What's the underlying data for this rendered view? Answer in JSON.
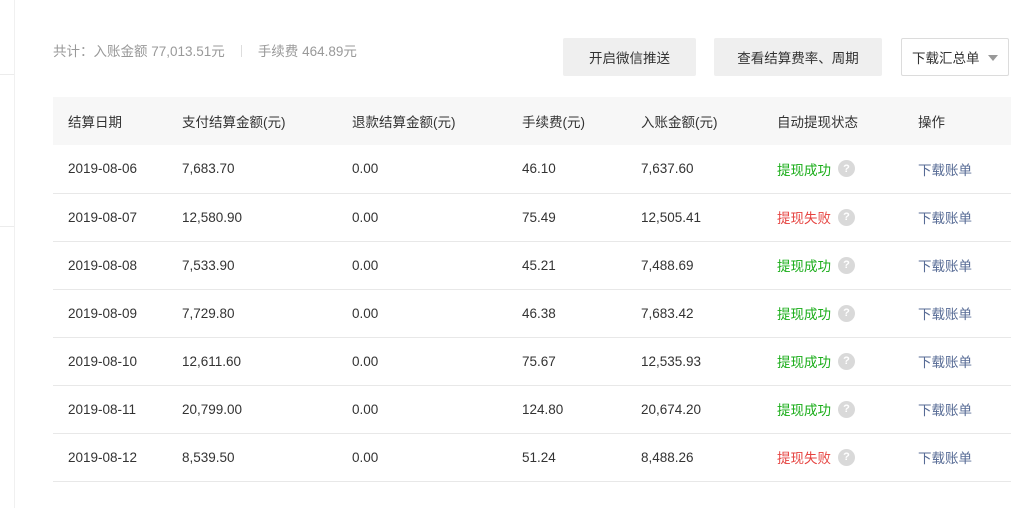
{
  "summary": {
    "income_text": "共计：入账金额 77,013.51元",
    "fee_text": "手续费 464.89元"
  },
  "toolbar": {
    "push_label": "开启微信推送",
    "rate_label": "查看结算费率、周期",
    "download_select_value": "下载汇总单"
  },
  "table": {
    "headers": [
      "结算日期",
      "支付结算金额(元)",
      "退款结算金额(元)",
      "手续费(元)",
      "入账金额(元)",
      "自动提现状态",
      "操作"
    ],
    "rows": [
      {
        "date": "2019-08-06",
        "pay": "7,683.70",
        "refund": "0.00",
        "fee": "46.10",
        "income": "7,637.60",
        "status": "提现成功",
        "status_type": "success",
        "help": "?",
        "action": "下载账单"
      },
      {
        "date": "2019-08-07",
        "pay": "12,580.90",
        "refund": "0.00",
        "fee": "75.49",
        "income": "12,505.41",
        "status": "提现失败",
        "status_type": "fail",
        "help": "?",
        "action": "下载账单"
      },
      {
        "date": "2019-08-08",
        "pay": "7,533.90",
        "refund": "0.00",
        "fee": "45.21",
        "income": "7,488.69",
        "status": "提现成功",
        "status_type": "success",
        "help": "?",
        "action": "下载账单"
      },
      {
        "date": "2019-08-09",
        "pay": "7,729.80",
        "refund": "0.00",
        "fee": "46.38",
        "income": "7,683.42",
        "status": "提现成功",
        "status_type": "success",
        "help": "?",
        "action": "下载账单"
      },
      {
        "date": "2019-08-10",
        "pay": "12,611.60",
        "refund": "0.00",
        "fee": "75.67",
        "income": "12,535.93",
        "status": "提现成功",
        "status_type": "success",
        "help": "?",
        "action": "下载账单"
      },
      {
        "date": "2019-08-11",
        "pay": "20,799.00",
        "refund": "0.00",
        "fee": "124.80",
        "income": "20,674.20",
        "status": "提现成功",
        "status_type": "success",
        "help": "?",
        "action": "下载账单"
      },
      {
        "date": "2019-08-12",
        "pay": "8,539.50",
        "refund": "0.00",
        "fee": "51.24",
        "income": "8,488.26",
        "status": "提现失败",
        "status_type": "fail",
        "help": "?",
        "action": "下载账单"
      }
    ]
  },
  "colors": {
    "success": "#1aad19",
    "fail": "#e64340",
    "link": "#576b95"
  }
}
